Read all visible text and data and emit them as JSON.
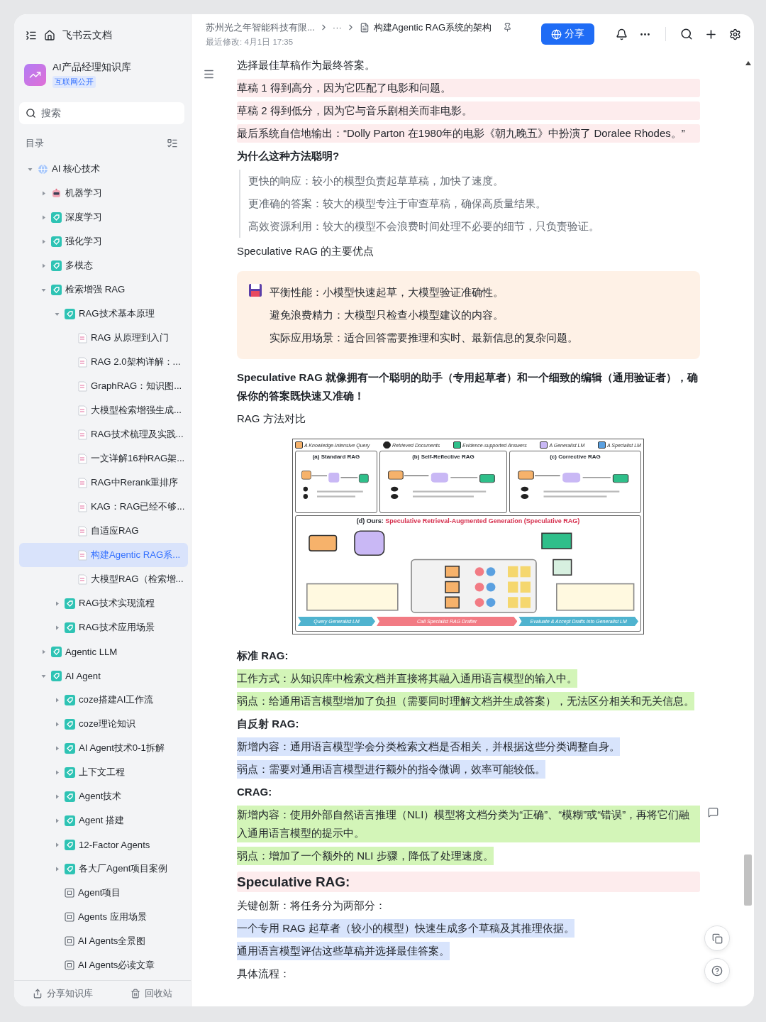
{
  "sidebar": {
    "app_title": "飞书云文档",
    "space": {
      "name": "AI产品经理知识库",
      "badge": "互联网公开"
    },
    "search": {
      "placeholder": "搜索"
    },
    "toc_label": "目录",
    "tree": [
      {
        "label": "AI 核心技术",
        "kind": "globe",
        "expanded": true,
        "selected": false,
        "children": [
          {
            "label": "机器学习",
            "kind": "robot",
            "expanded": false,
            "selected": false
          },
          {
            "label": "深度学习",
            "kind": "tag",
            "expanded": false,
            "selected": false
          },
          {
            "label": "强化学习",
            "kind": "tag",
            "expanded": false,
            "selected": false
          },
          {
            "label": "多模态",
            "kind": "tag",
            "expanded": false,
            "selected": false
          },
          {
            "label": "检索增强 RAG",
            "kind": "tag",
            "expanded": true,
            "selected": false,
            "children": [
              {
                "label": "RAG技术基本原理",
                "kind": "tag",
                "expanded": true,
                "selected": false,
                "children": [
                  {
                    "label": "RAG 从原理到入门",
                    "kind": "doc",
                    "selected": false
                  },
                  {
                    "label": "RAG 2.0架构详解：...",
                    "kind": "doc",
                    "selected": false
                  },
                  {
                    "label": "GraphRAG：知识图...",
                    "kind": "doc",
                    "selected": false
                  },
                  {
                    "label": "大模型检索增强生成...",
                    "kind": "doc",
                    "selected": false
                  },
                  {
                    "label": "RAG技术梳理及实践...",
                    "kind": "doc",
                    "selected": false
                  },
                  {
                    "label": "一文详解16种RAG架...",
                    "kind": "doc",
                    "selected": false
                  },
                  {
                    "label": "RAG中Rerank重排序",
                    "kind": "doc",
                    "selected": false
                  },
                  {
                    "label": "KAG：RAG已经不够...",
                    "kind": "doc",
                    "selected": false
                  },
                  {
                    "label": "自适应RAG",
                    "kind": "doc",
                    "selected": false
                  },
                  {
                    "label": "构建Agentic RAG系...",
                    "kind": "doc",
                    "selected": true
                  },
                  {
                    "label": "大模型RAG（检索增...",
                    "kind": "doc",
                    "selected": false
                  }
                ]
              },
              {
                "label": "RAG技术实现流程",
                "kind": "tag",
                "expanded": false,
                "selected": false
              },
              {
                "label": "RAG技术应用场景",
                "kind": "tag",
                "expanded": false,
                "selected": false
              }
            ]
          },
          {
            "label": "Agentic LLM",
            "kind": "tag",
            "expanded": false,
            "selected": false
          },
          {
            "label": "AI Agent",
            "kind": "tag",
            "expanded": true,
            "selected": false,
            "children": [
              {
                "label": "coze搭建AI工作流",
                "kind": "tag",
                "expanded": false,
                "selected": false
              },
              {
                "label": "coze理论知识",
                "kind": "tag",
                "expanded": false,
                "selected": false
              },
              {
                "label": "AI Agent技术0-1拆解",
                "kind": "tag",
                "expanded": false,
                "selected": false
              },
              {
                "label": "上下文工程",
                "kind": "tag",
                "expanded": false,
                "selected": false
              },
              {
                "label": "Agent技术",
                "kind": "tag",
                "expanded": false,
                "selected": false
              },
              {
                "label": "Agent 搭建",
                "kind": "tag",
                "expanded": false,
                "selected": false
              },
              {
                "label": "12-Factor Agents",
                "kind": "tag",
                "expanded": false,
                "selected": false
              },
              {
                "label": "各大厂Agent项目案例",
                "kind": "tag",
                "expanded": false,
                "selected": false
              },
              {
                "label": "Agent项目",
                "kind": "board",
                "selected": false
              },
              {
                "label": "Agents 应用场景",
                "kind": "board",
                "selected": false
              },
              {
                "label": "AI Agents全景图",
                "kind": "board",
                "selected": false
              },
              {
                "label": "AI Agents必读文章",
                "kind": "board",
                "selected": false
              }
            ]
          }
        ]
      }
    ],
    "footer": [
      "分享知识库",
      "回收站"
    ]
  },
  "header": {
    "breadcrumb": [
      "苏州光之年智能科技有限...",
      "···",
      "构建Agentic RAG系统的架构"
    ],
    "modified": "最近修改: 4月1日 17:35",
    "share_button": "分享"
  },
  "document": [
    {
      "kind": "para",
      "text": "选择最佳草稿作为最终答案。"
    },
    {
      "kind": "shaded",
      "color": "#fdeced",
      "text": "草稿 1 得到高分，因为它匹配了电影和问题。"
    },
    {
      "kind": "shaded",
      "color": "#fdeced",
      "text": "草稿 2 得到低分，因为它与音乐剧相关而非电影。"
    },
    {
      "kind": "shaded",
      "color": "#fdeced",
      "text": "最后系统自信地输出：“Dolly Parton 在1980年的电影《朝九晚五》中扮演了 Doralee Rhodes。”"
    },
    {
      "kind": "bold",
      "text": "为什么这种方法聪明?"
    },
    {
      "kind": "quote",
      "lines": [
        "更快的响应：较小的模型负责起草草稿，加快了速度。",
        "更准确的答案：较大的模型专注于审查草稿，确保高质量结果。",
        "高效资源利用：较大的模型不会浪费时间处理不必要的细节，只负责验证。"
      ]
    },
    {
      "kind": "para",
      "text": "Speculative RAG 的主要优点"
    },
    {
      "kind": "callout",
      "color": "#fef1e6",
      "lines": [
        "平衡性能：小模型快速起草，大模型验证准确性。",
        "避免浪费精力：大模型只检查小模型建议的内容。",
        "实际应用场景：适合回答需要推理和实时、最新信息的复杂问题。"
      ]
    },
    {
      "kind": "bold",
      "text": "Speculative RAG 就像拥有一个聪明的助手（专用起草者）和一个细致的编辑（通用验证者），确保你的答案既快速又准确！"
    },
    {
      "kind": "para",
      "text": "RAG 方法对比"
    },
    {
      "kind": "figure",
      "legend": [
        "A Knowledge-Intensive Query",
        "Retrieved Documents",
        "Evidence-supported Answers",
        "A Generalist LM",
        "A Specialist LM"
      ],
      "panels": [
        "(a) Standard RAG",
        "(b) Self-Reflective RAG",
        "(c) Corrective RAG"
      ],
      "main_title": "(d) Ours: ",
      "main_title_highlight": "Speculative Retrieval-Augmented Generation (Speculative RAG)",
      "stages": [
        {
          "label": "Query Generalist LM",
          "color": "#4fb3cf"
        },
        {
          "label": "Call Specialist RAG Drafter",
          "color": "#f27b84"
        },
        {
          "label": "Evaluate & Accept Drafts into Generalist LM",
          "color": "#4fb3cf"
        }
      ]
    },
    {
      "kind": "bold",
      "text": "标准 RAG:"
    },
    {
      "kind": "marked",
      "color": "#d3f5b8",
      "text": "工作方式：从知识库中检索文档并直接将其融入通用语言模型的输入中。"
    },
    {
      "kind": "marked",
      "color": "#d3f5b8",
      "text": "弱点：给通用语言模型增加了负担（需要同时理解文档并生成答案），无法区分相关和无关信息。"
    },
    {
      "kind": "bold",
      "text": "自反射 RAG:"
    },
    {
      "kind": "marked",
      "color": "#d8e4fc",
      "text": "新增内容：通用语言模型学会分类检索文档是否相关，并根据这些分类调整自身。"
    },
    {
      "kind": "marked",
      "color": "#d8e4fc",
      "text": "弱点：需要对通用语言模型进行额外的指令微调，效率可能较低。"
    },
    {
      "kind": "bold",
      "text": "CRAG:"
    },
    {
      "kind": "marked",
      "color": "#d3f5b8",
      "comment": true,
      "text": "新增内容：使用外部自然语言推理（NLI）模型将文档分类为“正确”、“模糊”或“错误”，再将它们融入通用语言模型的提示中。"
    },
    {
      "kind": "marked",
      "color": "#d3f5b8",
      "text": "弱点：增加了一个额外的 NLI 步骤，降低了处理速度。"
    },
    {
      "kind": "heading",
      "color": "#fdeced",
      "text": "Speculative RAG:"
    },
    {
      "kind": "para",
      "text": "关键创新：将任务分为两部分："
    },
    {
      "kind": "marked",
      "color": "#d8e4fc",
      "text": "一个专用 RAG 起草者（较小的模型）快速生成多个草稿及其推理依据。"
    },
    {
      "kind": "marked",
      "color": "#d8e4fc",
      "text": "通用语言模型评估这些草稿并选择最佳答案。"
    },
    {
      "kind": "para",
      "text": "具体流程："
    }
  ]
}
